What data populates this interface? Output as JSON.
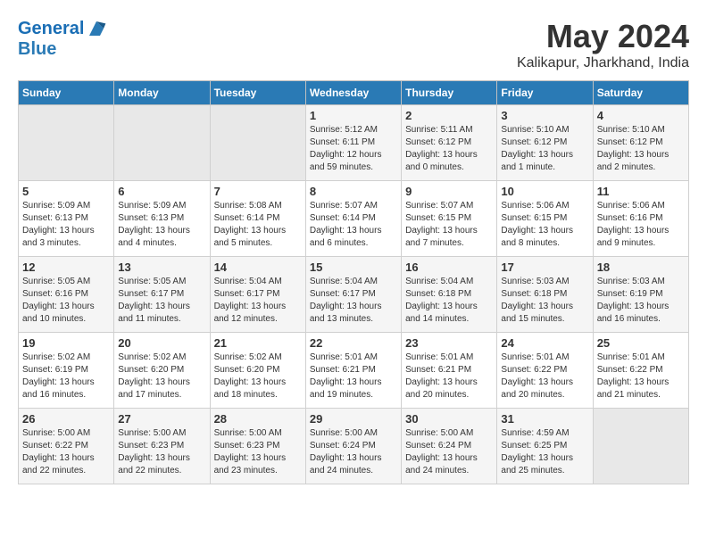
{
  "logo": {
    "line1": "General",
    "line2": "Blue"
  },
  "title": {
    "month_year": "May 2024",
    "location": "Kalikapur, Jharkhand, India"
  },
  "weekdays": [
    "Sunday",
    "Monday",
    "Tuesday",
    "Wednesday",
    "Thursday",
    "Friday",
    "Saturday"
  ],
  "weeks": [
    [
      {
        "day": "",
        "info": ""
      },
      {
        "day": "",
        "info": ""
      },
      {
        "day": "",
        "info": ""
      },
      {
        "day": "1",
        "info": "Sunrise: 5:12 AM\nSunset: 6:11 PM\nDaylight: 12 hours and 59 minutes."
      },
      {
        "day": "2",
        "info": "Sunrise: 5:11 AM\nSunset: 6:12 PM\nDaylight: 13 hours and 0 minutes."
      },
      {
        "day": "3",
        "info": "Sunrise: 5:10 AM\nSunset: 6:12 PM\nDaylight: 13 hours and 1 minute."
      },
      {
        "day": "4",
        "info": "Sunrise: 5:10 AM\nSunset: 6:12 PM\nDaylight: 13 hours and 2 minutes."
      }
    ],
    [
      {
        "day": "5",
        "info": "Sunrise: 5:09 AM\nSunset: 6:13 PM\nDaylight: 13 hours and 3 minutes."
      },
      {
        "day": "6",
        "info": "Sunrise: 5:09 AM\nSunset: 6:13 PM\nDaylight: 13 hours and 4 minutes."
      },
      {
        "day": "7",
        "info": "Sunrise: 5:08 AM\nSunset: 6:14 PM\nDaylight: 13 hours and 5 minutes."
      },
      {
        "day": "8",
        "info": "Sunrise: 5:07 AM\nSunset: 6:14 PM\nDaylight: 13 hours and 6 minutes."
      },
      {
        "day": "9",
        "info": "Sunrise: 5:07 AM\nSunset: 6:15 PM\nDaylight: 13 hours and 7 minutes."
      },
      {
        "day": "10",
        "info": "Sunrise: 5:06 AM\nSunset: 6:15 PM\nDaylight: 13 hours and 8 minutes."
      },
      {
        "day": "11",
        "info": "Sunrise: 5:06 AM\nSunset: 6:16 PM\nDaylight: 13 hours and 9 minutes."
      }
    ],
    [
      {
        "day": "12",
        "info": "Sunrise: 5:05 AM\nSunset: 6:16 PM\nDaylight: 13 hours and 10 minutes."
      },
      {
        "day": "13",
        "info": "Sunrise: 5:05 AM\nSunset: 6:17 PM\nDaylight: 13 hours and 11 minutes."
      },
      {
        "day": "14",
        "info": "Sunrise: 5:04 AM\nSunset: 6:17 PM\nDaylight: 13 hours and 12 minutes."
      },
      {
        "day": "15",
        "info": "Sunrise: 5:04 AM\nSunset: 6:17 PM\nDaylight: 13 hours and 13 minutes."
      },
      {
        "day": "16",
        "info": "Sunrise: 5:04 AM\nSunset: 6:18 PM\nDaylight: 13 hours and 14 minutes."
      },
      {
        "day": "17",
        "info": "Sunrise: 5:03 AM\nSunset: 6:18 PM\nDaylight: 13 hours and 15 minutes."
      },
      {
        "day": "18",
        "info": "Sunrise: 5:03 AM\nSunset: 6:19 PM\nDaylight: 13 hours and 16 minutes."
      }
    ],
    [
      {
        "day": "19",
        "info": "Sunrise: 5:02 AM\nSunset: 6:19 PM\nDaylight: 13 hours and 16 minutes."
      },
      {
        "day": "20",
        "info": "Sunrise: 5:02 AM\nSunset: 6:20 PM\nDaylight: 13 hours and 17 minutes."
      },
      {
        "day": "21",
        "info": "Sunrise: 5:02 AM\nSunset: 6:20 PM\nDaylight: 13 hours and 18 minutes."
      },
      {
        "day": "22",
        "info": "Sunrise: 5:01 AM\nSunset: 6:21 PM\nDaylight: 13 hours and 19 minutes."
      },
      {
        "day": "23",
        "info": "Sunrise: 5:01 AM\nSunset: 6:21 PM\nDaylight: 13 hours and 20 minutes."
      },
      {
        "day": "24",
        "info": "Sunrise: 5:01 AM\nSunset: 6:22 PM\nDaylight: 13 hours and 20 minutes."
      },
      {
        "day": "25",
        "info": "Sunrise: 5:01 AM\nSunset: 6:22 PM\nDaylight: 13 hours and 21 minutes."
      }
    ],
    [
      {
        "day": "26",
        "info": "Sunrise: 5:00 AM\nSunset: 6:22 PM\nDaylight: 13 hours and 22 minutes."
      },
      {
        "day": "27",
        "info": "Sunrise: 5:00 AM\nSunset: 6:23 PM\nDaylight: 13 hours and 22 minutes."
      },
      {
        "day": "28",
        "info": "Sunrise: 5:00 AM\nSunset: 6:23 PM\nDaylight: 13 hours and 23 minutes."
      },
      {
        "day": "29",
        "info": "Sunrise: 5:00 AM\nSunset: 6:24 PM\nDaylight: 13 hours and 24 minutes."
      },
      {
        "day": "30",
        "info": "Sunrise: 5:00 AM\nSunset: 6:24 PM\nDaylight: 13 hours and 24 minutes."
      },
      {
        "day": "31",
        "info": "Sunrise: 4:59 AM\nSunset: 6:25 PM\nDaylight: 13 hours and 25 minutes."
      },
      {
        "day": "",
        "info": ""
      }
    ]
  ]
}
